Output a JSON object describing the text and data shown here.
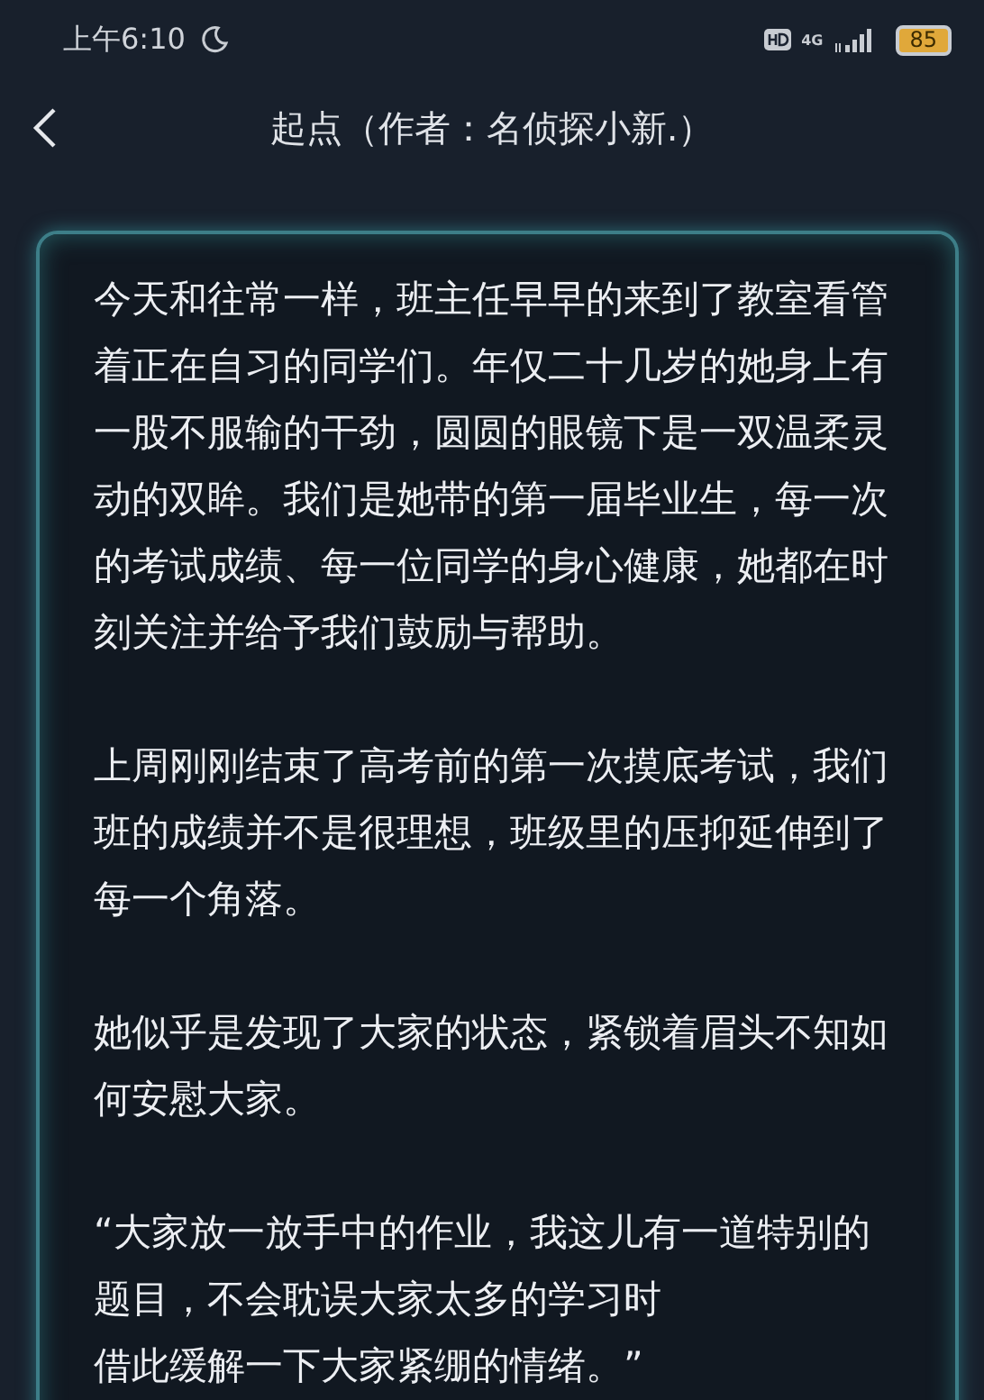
{
  "status_bar": {
    "time": "上午6:10",
    "network": "4G",
    "battery": "85"
  },
  "nav": {
    "title": "起点（作者：名侦探小新.）"
  },
  "paragraphs": [
    {
      "lines": [
        "今天和往常一样，班主任早早的来到了教室看管",
        "着正在自习的同学们。年仅二十几岁的她身上有",
        "一股不服输的干劲，圆圆的眼镜下是一双温柔灵",
        "动的双眸。我们是她带的第一届毕业生，每一次",
        "的考试成绩、每一位同学的身心健康，她都在时",
        "刻关注并给予我们鼓励与帮助。"
      ]
    },
    {
      "lines": [
        "上周刚刚结束了高考前的第一次摸底考试，我们",
        "班的成绩并不是很理想，班级里的压抑延伸到了",
        "每一个角落。"
      ]
    },
    {
      "lines": [
        "她似乎是发现了大家的状态，紧锁着眉头不知如",
        "何安慰大家。"
      ]
    },
    {
      "lines": [
        "“大家放一放手中的作业，我这儿有一道特别的",
        "题目，不会耽误大家太多的学习时",
        "借此缓解一下大家紧绷的情绪。”"
      ]
    }
  ]
}
